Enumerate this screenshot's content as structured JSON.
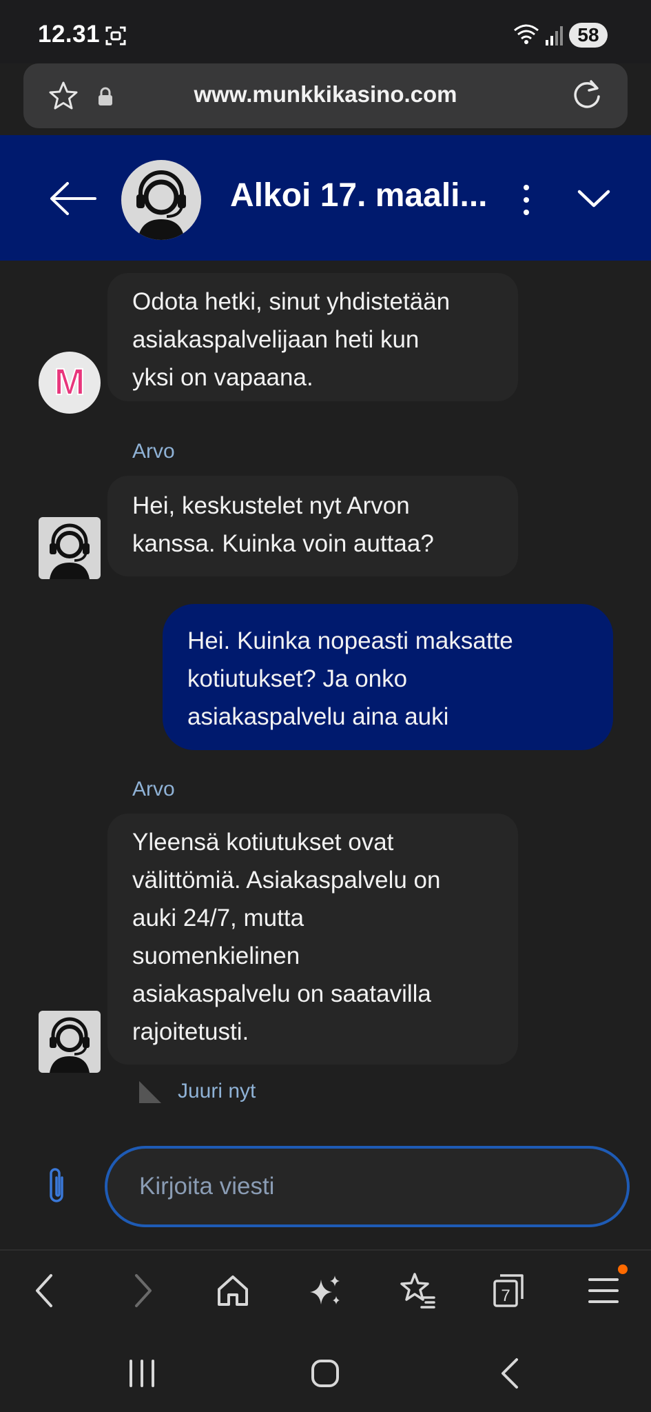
{
  "status_bar": {
    "time": "12.31",
    "battery": "58"
  },
  "browser": {
    "url": "www.munkkikasino.com",
    "tab_count": "7"
  },
  "chat": {
    "title": "Alkoi 17. maali...",
    "messages": [
      {
        "type": "system",
        "text_lines": [
          "Odota hetki, sinut yhdistetään",
          "asiakaspalvelijaan heti kun",
          "yksi on vapaana."
        ]
      },
      {
        "type": "agent",
        "sender": "Arvo",
        "text_lines": [
          "Hei, keskustelet nyt Arvon",
          "kanssa. Kuinka voin auttaa?"
        ]
      },
      {
        "type": "user",
        "text_lines": [
          "Hei. Kuinka nopeasti maksatte",
          "kotiutukset? Ja onko",
          "asiakaspalvelu aina auki"
        ]
      },
      {
        "type": "agent",
        "sender": "Arvo",
        "text_lines": [
          "Yleensä kotiutukset ovat",
          "välittömiä. Asiakaspalvelu on",
          "auki 24/7, mutta",
          "suomenkielinen",
          "asiakaspalvelu on saatavilla",
          "rajoitetusti."
        ],
        "timestamp": "Juuri nyt"
      }
    ],
    "composer": {
      "placeholder": "Kirjoita viesti"
    },
    "avatar_letter": "M"
  },
  "colors": {
    "header_bg": "#001a6e",
    "user_bubble": "#001a6e",
    "bubble_bg": "#262626",
    "accent": "#1e5bb5",
    "meta_text": "#8fb2d6"
  }
}
